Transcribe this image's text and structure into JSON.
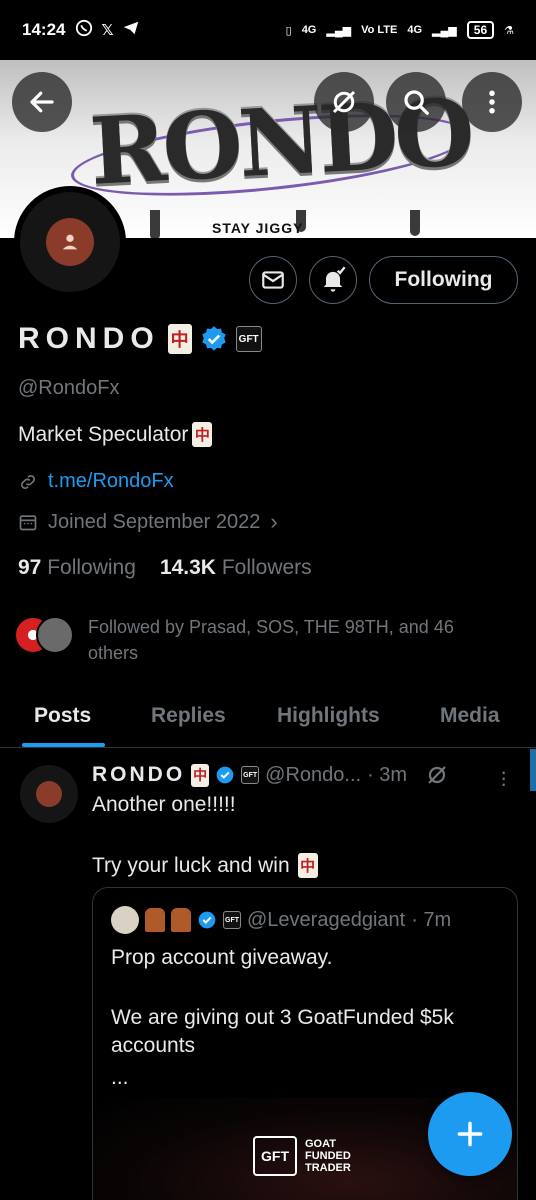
{
  "status_bar": {
    "time": "14:24",
    "network_1": "4G",
    "network_2": "Vo LTE",
    "network_3": "4G",
    "battery": "56"
  },
  "banner": {
    "title": "RONDO",
    "subtitle": "STAY JIGGY"
  },
  "profile": {
    "name": "RONDO",
    "name_emoji": "🀄",
    "handle": "@RondoFx",
    "bio": "Market Speculator",
    "bio_emoji": "🀄",
    "link": "t.me/RondoFx",
    "joined": "Joined September 2022",
    "following_count": "97",
    "following_label": "Following",
    "followers_count": "14.3K",
    "followers_label": "Followers",
    "followed_by": "Followed by Prasad, SOS, THE 98TH, and 46 others",
    "affiliate_badge": "GFT"
  },
  "actions": {
    "following_button": "Following"
  },
  "tabs": [
    {
      "label": "Posts",
      "active": true
    },
    {
      "label": "Replies",
      "active": false
    },
    {
      "label": "Highlights",
      "active": false
    },
    {
      "label": "Media",
      "active": false
    }
  ],
  "post": {
    "author": "RONDO",
    "handle": "@Rondo...",
    "time": "· 3m",
    "text_line1": "Another one!!!!!",
    "text_line2": "Try your luck and win",
    "quote": {
      "handle": "@Leveragedgiant",
      "time": "· 7m",
      "text_1": "Prop account giveaway.",
      "text_2": "We are giving out 3 GoatFunded $5k accounts",
      "text_3": "...",
      "logo_line1": "GOAT",
      "logo_line2": "FUNDED",
      "logo_line3": "TRADER",
      "logo_mark": "GFT"
    }
  },
  "colors": {
    "accent": "#1d9bf0",
    "muted": "#71767b",
    "text": "#e7e9ea",
    "background": "#000000"
  }
}
